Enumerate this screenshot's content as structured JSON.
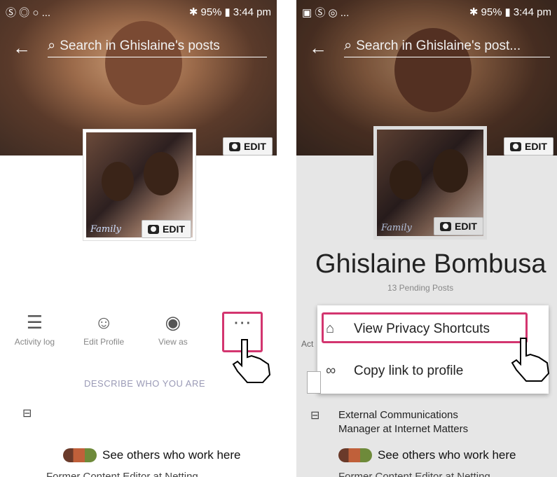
{
  "left": {
    "status_time": "3:44 pm",
    "status_battery": "95%",
    "status_left": "Ⓢ ◎ ○ ...",
    "search_text": "Search in Ghislaine's posts",
    "cover_edit_label": "EDIT",
    "profile_edit_label": "EDIT",
    "signature": "Family",
    "faded_name": "",
    "actions": [
      {
        "icon": "activity-log-icon",
        "glyph": "☰",
        "label": "Activity log"
      },
      {
        "icon": "edit-profile-icon",
        "glyph": "☺",
        "label": "Edit Profile"
      },
      {
        "icon": "view-as-icon",
        "glyph": "◉",
        "label": "View as"
      },
      {
        "icon": "more-icon",
        "glyph": "⋯",
        "label": ""
      }
    ],
    "describe_text": "DESCRIBE WHO YOU ARE",
    "see_others": "See others who work here",
    "cut_text": "Former Content Editor at Netting"
  },
  "right": {
    "status_time": "3:44 pm",
    "status_battery": "95%",
    "status_left": "▣ Ⓢ ◎ ...",
    "search_text": "Search in Ghislaine's post...",
    "cover_edit_label": "EDIT",
    "profile_edit_label": "EDIT",
    "signature": "Family",
    "profile_name": "Ghislaine Bombusa",
    "pending": "13 Pending Posts",
    "partial_label": "Act",
    "menu": {
      "view_privacy": "View Privacy Shortcuts",
      "copy_link": "Copy link to profile"
    },
    "job_line1": "External Communications",
    "job_line2": "Manager at Internet Matters",
    "see_others": "See others who work here",
    "cut_text": "Former Content Editor at Netting"
  },
  "colors": {
    "highlight": "#d3356f"
  }
}
